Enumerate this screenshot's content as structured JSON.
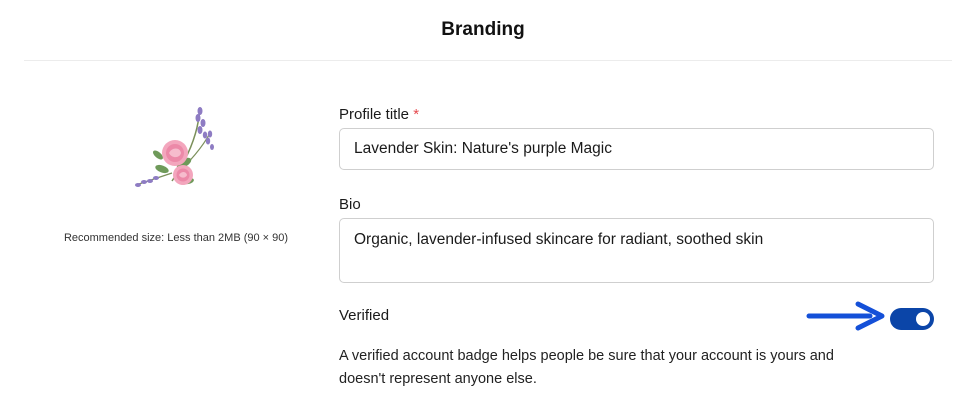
{
  "header": {
    "title": "Branding"
  },
  "avatar": {
    "caption": "Recommended size: Less than 2MB (90 × 90)"
  },
  "profile_title": {
    "label": "Profile title",
    "required_mark": "*",
    "value": "Lavender Skin: Nature's purple Magic"
  },
  "bio": {
    "label": "Bio",
    "value": "Organic, lavender-infused skincare for radiant, soothed skin"
  },
  "verified": {
    "label": "Verified",
    "enabled": true,
    "description": "A verified account badge helps people be sure that your account is yours and doesn't represent anyone else."
  },
  "colors": {
    "toggle_on": "#0b45a8",
    "arrow": "#1450d8",
    "required": "#e5484d"
  },
  "icons": {
    "avatar": "rose-lavender-illustration",
    "pointer": "arrow-right-icon"
  }
}
